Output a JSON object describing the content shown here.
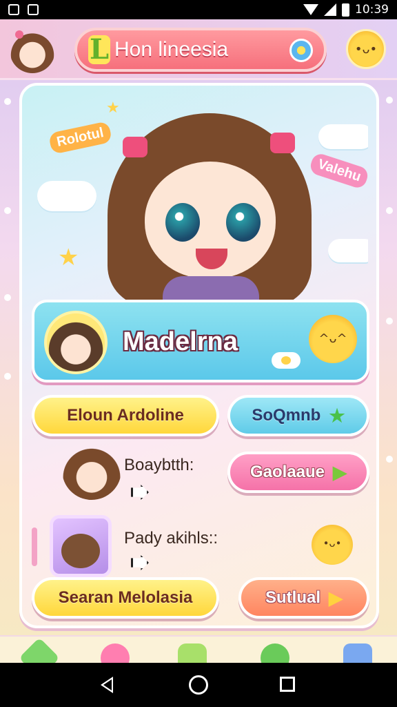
{
  "status_bar": {
    "time": "10:39"
  },
  "header": {
    "title_badge": "L",
    "title": "Hon lineesia"
  },
  "hero": {
    "sticker_left": "Rolotul",
    "sticker_right": "Valehu"
  },
  "profile": {
    "name": "Madelrna"
  },
  "buttons": {
    "elounardoline": "Eloun Ardoline",
    "soamnb": "SoQmnb",
    "gaolaaue": "Gaolaaue",
    "searan": "Searan Melolasia",
    "sutlual": "Sutlual"
  },
  "rows": {
    "row1_label": "Boaybtth:",
    "row2_label": "Pady akihls::"
  },
  "colors": {
    "accent_pink": "#f6707c",
    "accent_blue": "#5bc8ea",
    "accent_yellow": "#ffd73b"
  },
  "icons": [
    "settings-icon",
    "image-icon",
    "wifi-icon",
    "signal-icon",
    "battery-icon",
    "flower-icon",
    "mascot-icon",
    "star-icon",
    "play-icon",
    "arrow-icon",
    "back-icon",
    "home-icon",
    "recents-icon"
  ]
}
